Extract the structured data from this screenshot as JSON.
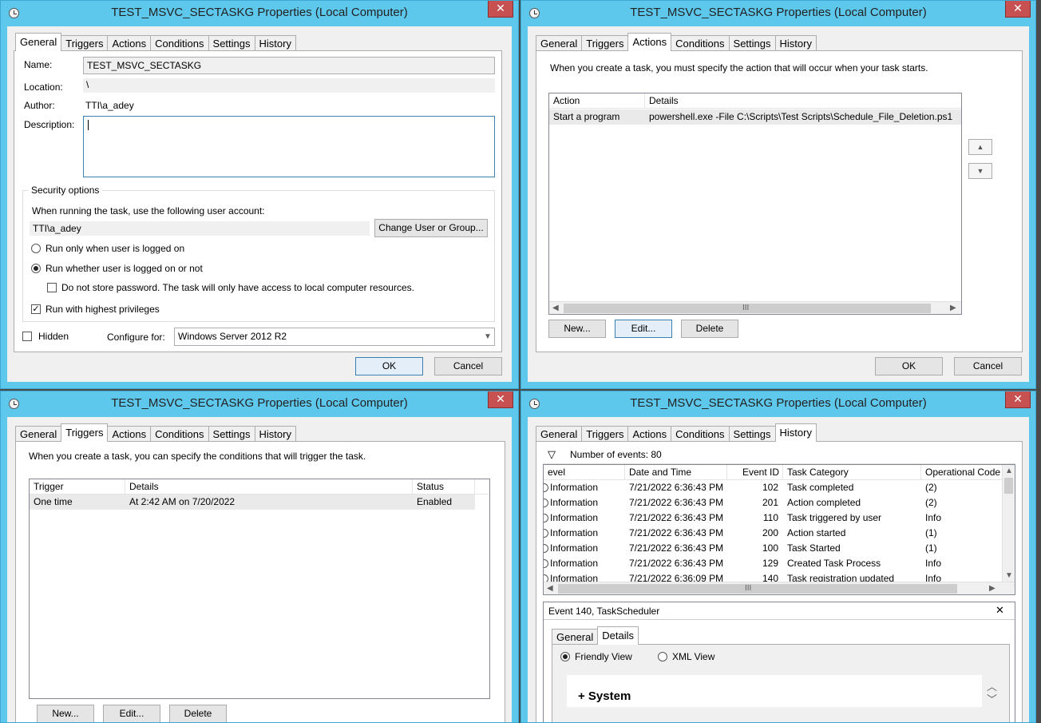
{
  "dialog_title": "TEST_MSVC_SECTASKG Properties (Local Computer)",
  "close_glyph": "✕",
  "tabs": [
    "General",
    "Triggers",
    "Actions",
    "Conditions",
    "Settings",
    "History"
  ],
  "general": {
    "name_label": "Name:",
    "name_value": "TEST_MSVC_SECTASKG",
    "location_label": "Location:",
    "location_value": "\\",
    "author_label": "Author:",
    "author_value": "TTI\\a_adey",
    "description_label": "Description:",
    "description_value": "",
    "security_title": "Security options",
    "security_prompt": "When running the task, use the following user account:",
    "account_value": "TTI\\a_adey",
    "change_user_button": "Change User or Group...",
    "radio_logged_on": "Run only when user is logged on",
    "radio_whether": "Run whether user is logged on or not",
    "do_not_store": "Do not store password.  The task will only have access to local computer resources.",
    "highest_privileges": "Run with highest privileges",
    "hidden_label": "Hidden",
    "configure_label": "Configure for:",
    "configure_value": "Windows Server 2012 R2",
    "ok": "OK",
    "cancel": "Cancel"
  },
  "actions": {
    "intro": "When you create a task, you must specify the action that will occur when your task starts.",
    "columns": [
      "Action",
      "Details"
    ],
    "rows": [
      {
        "action": "Start a program",
        "details": "powershell.exe -File C:\\Scripts\\Test Scripts\\Schedule_File_Deletion.ps1"
      }
    ],
    "scroll_grip": "III",
    "up_arrow": "▲",
    "down_arrow": "▼",
    "new": "New...",
    "edit": "Edit...",
    "delete": "Delete",
    "ok": "OK",
    "cancel": "Cancel"
  },
  "triggers": {
    "intro": "When you create a task, you can specify the conditions that will trigger the task.",
    "columns": [
      "Trigger",
      "Details",
      "Status"
    ],
    "rows": [
      {
        "trigger": "One time",
        "details": "At 2:42 AM on 7/20/2022",
        "status": "Enabled"
      }
    ],
    "new": "New...",
    "edit": "Edit...",
    "delete": "Delete"
  },
  "history": {
    "filter_glyph": "▽",
    "count_text": "Number of events: 80",
    "columns": [
      "evel",
      "Date and Time",
      "Event ID",
      "Task Category",
      "Operational Code"
    ],
    "rows": [
      {
        "level": "Information",
        "date": "7/21/2022 6:36:43 PM",
        "id": "102",
        "category": "Task completed",
        "op": "(2)"
      },
      {
        "level": "Information",
        "date": "7/21/2022 6:36:43 PM",
        "id": "201",
        "category": "Action completed",
        "op": "(2)"
      },
      {
        "level": "Information",
        "date": "7/21/2022 6:36:43 PM",
        "id": "110",
        "category": "Task triggered by user",
        "op": "Info"
      },
      {
        "level": "Information",
        "date": "7/21/2022 6:36:43 PM",
        "id": "200",
        "category": "Action started",
        "op": "(1)"
      },
      {
        "level": "Information",
        "date": "7/21/2022 6:36:43 PM",
        "id": "100",
        "category": "Task Started",
        "op": "(1)"
      },
      {
        "level": "Information",
        "date": "7/21/2022 6:36:43 PM",
        "id": "129",
        "category": "Created Task Process",
        "op": "Info"
      },
      {
        "level": "Information",
        "date": "7/21/2022 6:36:09 PM",
        "id": "140",
        "category": "Task registration updated",
        "op": "Info"
      }
    ],
    "scroll_grip": "III",
    "detail_title": "Event 140, TaskScheduler",
    "detail_close": "✕",
    "detail_tabs": [
      "General",
      "Details"
    ],
    "friendly_view": "Friendly View",
    "xml_view": "XML View",
    "system_label": "+ System"
  }
}
